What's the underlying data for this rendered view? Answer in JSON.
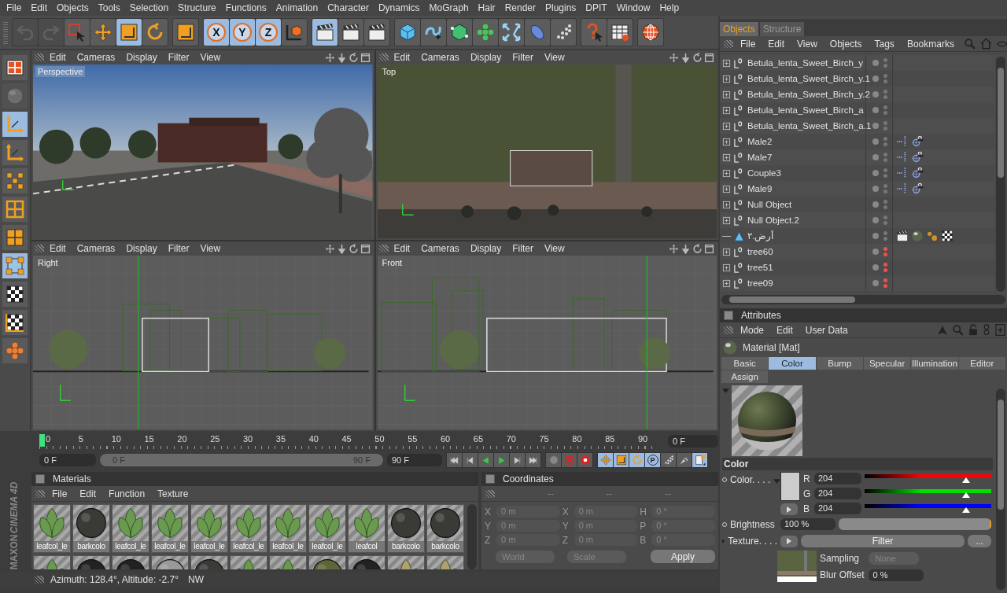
{
  "menu": [
    "File",
    "Edit",
    "Objects",
    "Tools",
    "Selection",
    "Structure",
    "Functions",
    "Animation",
    "Character",
    "Dynamics",
    "MoGraph",
    "Hair",
    "Render",
    "Plugins",
    "DPIT",
    "Window",
    "Help"
  ],
  "toolbar": [
    [
      {
        "kind": "undo",
        "selected": false,
        "disabled": true
      },
      {
        "kind": "redo",
        "selected": false,
        "disabled": true
      },
      {
        "kind": "select",
        "selected": false,
        "disabled": false
      },
      {
        "kind": "move",
        "selected": false,
        "disabled": false
      },
      {
        "kind": "scale",
        "selected": true,
        "disabled": false
      },
      {
        "kind": "rotate",
        "selected": false,
        "disabled": false
      }
    ],
    [
      {
        "kind": "square",
        "selected": false,
        "disabled": false
      }
    ],
    [
      {
        "kind": "axis_lock",
        "label": "X",
        "selected": true,
        "disabled": false
      },
      {
        "kind": "axis_lock",
        "label": "Y",
        "selected": true,
        "disabled": false
      },
      {
        "kind": "axis_lock",
        "label": "Z",
        "selected": true,
        "disabled": false
      },
      {
        "kind": "coord",
        "selected": false,
        "disabled": false
      }
    ],
    [
      {
        "kind": "clapper",
        "selected": true,
        "disabled": false
      },
      {
        "kind": "clapper",
        "selected": false,
        "disabled": false
      },
      {
        "kind": "clapper",
        "selected": false,
        "disabled": false
      }
    ],
    [
      {
        "kind": "cube",
        "selected": false,
        "disabled": false
      },
      {
        "kind": "spline",
        "selected": false,
        "disabled": false
      },
      {
        "kind": "nurbs",
        "selected": false,
        "disabled": false
      },
      {
        "kind": "array",
        "selected": false,
        "disabled": false
      },
      {
        "kind": "deformer",
        "selected": false,
        "disabled": false
      },
      {
        "kind": "env",
        "selected": false,
        "disabled": false
      },
      {
        "kind": "particles",
        "selected": false,
        "disabled": false
      }
    ],
    [
      {
        "kind": "help",
        "selected": false,
        "disabled": false
      },
      {
        "kind": "info",
        "selected": false,
        "disabled": false
      }
    ],
    [
      {
        "kind": "web",
        "selected": false,
        "disabled": false
      }
    ]
  ],
  "left_tools": [
    {
      "kind": "layout",
      "selected": false,
      "disabled": false
    },
    {
      "kind": "sphere",
      "selected": false,
      "disabled": true
    },
    {
      "kind": "axis",
      "selected": true,
      "disabled": false
    },
    {
      "kind": "axis",
      "selected": false,
      "disabled": false
    },
    {
      "kind": "points",
      "selected": false,
      "disabled": false
    },
    {
      "kind": "grid",
      "selected": false,
      "disabled": false
    },
    {
      "kind": "polygons",
      "selected": false,
      "disabled": false
    },
    {
      "kind": "nodes",
      "selected": true,
      "disabled": false
    },
    {
      "kind": "checker",
      "selected": false,
      "disabled": false
    },
    {
      "kind": "checkaxis",
      "selected": false,
      "disabled": false
    },
    {
      "kind": "sculpt",
      "selected": false,
      "disabled": false
    }
  ],
  "logo": [
    "MAXON",
    "CINEMA 4D"
  ],
  "viewports": [
    {
      "kind": "perspective",
      "label": "Perspective",
      "menu": [
        "Edit",
        "Cameras",
        "Display",
        "Filter",
        "View"
      ]
    },
    {
      "kind": "top",
      "label": "Top",
      "menu": [
        "Edit",
        "Cameras",
        "Display",
        "Filter",
        "View"
      ]
    },
    {
      "kind": "right",
      "label": "Right",
      "menu": [
        "Edit",
        "Cameras",
        "Display",
        "Filter",
        "View"
      ]
    },
    {
      "kind": "front",
      "label": "Front",
      "menu": [
        "Edit",
        "Cameras",
        "Display",
        "Filter",
        "View"
      ]
    }
  ],
  "timeline": {
    "ticks": [
      "0",
      "5",
      "10",
      "15",
      "20",
      "25",
      "30",
      "35",
      "40",
      "45",
      "50",
      "55",
      "60",
      "65",
      "70",
      "75",
      "80",
      "85",
      "90"
    ],
    "playhead": {
      "level": 0
    },
    "current": "0 F"
  },
  "range": {
    "start": "0 F",
    "slider_start": "0 F",
    "slider_end": "90 F",
    "end": "90 F",
    "level": 1
  },
  "playback": [
    {
      "kind": "first",
      "selected": false
    },
    {
      "kind": "prevkey",
      "selected": false
    },
    {
      "kind": "prev",
      "selected": false
    },
    {
      "kind": "play",
      "selected": false
    },
    {
      "kind": "nextkey",
      "selected": false
    },
    {
      "kind": "last",
      "selected": false
    }
  ],
  "record": [
    {
      "kind": "recgrey",
      "selected": false
    },
    {
      "kind": "rec",
      "selected": false
    },
    {
      "kind": "autokey",
      "selected": false
    }
  ],
  "modes": [
    {
      "kind": "move",
      "selected": true
    },
    {
      "kind": "scale",
      "selected": true
    },
    {
      "kind": "rotate",
      "selected": true
    },
    {
      "kind": "param",
      "label": "P",
      "selected": true
    },
    {
      "kind": "particles",
      "selected": false
    },
    {
      "kind": "light",
      "selected": false
    },
    {
      "kind": "doc",
      "selected": true
    }
  ],
  "materials": {
    "title": "Materials",
    "menu": [
      "File",
      "Edit",
      "Function",
      "Texture"
    ],
    "items": [
      {
        "kind": "leaf",
        "name": "leafcol_le"
      },
      {
        "kind": "bark",
        "name": "barkcolo"
      },
      {
        "kind": "leaf",
        "name": "leafcol_le"
      },
      {
        "kind": "leaf",
        "name": "leafcol_le"
      },
      {
        "kind": "leaf",
        "name": "leafcol_le"
      },
      {
        "kind": "leaf",
        "name": "leafcol_le"
      },
      {
        "kind": "leaf",
        "name": "leafcol_le"
      },
      {
        "kind": "leaf",
        "name": "leafcol_le"
      },
      {
        "kind": "leaf",
        "name": "leafcol"
      },
      {
        "kind": "bark",
        "name": "barkcolo"
      },
      {
        "kind": "bark",
        "name": "barkcolo"
      }
    ],
    "second_row": [
      {
        "kind": "leaf"
      },
      {
        "kind": "dark"
      },
      {
        "kind": "dark"
      },
      {
        "kind": "grey"
      },
      {
        "kind": "bark"
      },
      {
        "kind": "leaf"
      },
      {
        "kind": "leaf"
      },
      {
        "kind": "olive"
      },
      {
        "kind": "dark"
      },
      {
        "kind": "grass"
      },
      {
        "kind": "grass"
      }
    ]
  },
  "coordinates": {
    "title": "Coordinates",
    "columns": [
      "--",
      "--",
      "--"
    ],
    "disabled": true,
    "rows": [
      [
        {
          "axis": "X",
          "value": "0 m"
        },
        {
          "axis": "X",
          "value": "0 m"
        },
        {
          "axis": "H",
          "value": "0 °"
        }
      ],
      [
        {
          "axis": "Y",
          "value": "0 m"
        },
        {
          "axis": "Y",
          "value": "0 m"
        },
        {
          "axis": "P",
          "value": "0 °"
        }
      ],
      [
        {
          "axis": "Z",
          "value": "0 m"
        },
        {
          "axis": "Z",
          "value": "0 m"
        },
        {
          "axis": "B",
          "value": "0 °"
        }
      ]
    ],
    "space": "World",
    "mode": "Scale",
    "apply": "Apply"
  },
  "status": {
    "text": "Azimuth: 128.4°, Altitude: -2.7°",
    "direction": "NW"
  },
  "objects": {
    "tabs": [
      {
        "label": "Objects",
        "selected": true
      },
      {
        "label": "Structure",
        "selected": false
      }
    ],
    "menu": [
      "File",
      "Edit",
      "View",
      "Objects",
      "Tags",
      "Bookmarks"
    ],
    "rows": [
      {
        "name": "Betula_lenta_Sweet_Birch_y",
        "kind": "null",
        "expandable": true,
        "hidden": false,
        "tags": []
      },
      {
        "name": "Betula_lenta_Sweet_Birch_y.1",
        "kind": "null",
        "expandable": true,
        "hidden": false,
        "tags": []
      },
      {
        "name": "Betula_lenta_Sweet_Birch_y.2",
        "kind": "null",
        "expandable": true,
        "hidden": false,
        "tags": []
      },
      {
        "name": "Betula_lenta_Sweet_Birch_a",
        "kind": "null",
        "expandable": true,
        "hidden": false,
        "tags": []
      },
      {
        "name": "Betula_lenta_Sweet_Birch_a.1",
        "kind": "null",
        "expandable": true,
        "hidden": false,
        "tags": []
      },
      {
        "name": "Male2",
        "kind": "null",
        "expandable": true,
        "hidden": false,
        "tags": [
          {
            "kind": "ik"
          },
          {
            "kind": "motion"
          }
        ]
      },
      {
        "name": "Male7",
        "kind": "null",
        "expandable": true,
        "hidden": false,
        "tags": [
          {
            "kind": "ik"
          },
          {
            "kind": "motion"
          }
        ]
      },
      {
        "name": "Couple3",
        "kind": "null",
        "expandable": true,
        "hidden": false,
        "tags": [
          {
            "kind": "ik"
          },
          {
            "kind": "motion"
          }
        ]
      },
      {
        "name": "Male9",
        "kind": "null",
        "expandable": true,
        "hidden": false,
        "tags": [
          {
            "kind": "ik"
          },
          {
            "kind": "motion"
          }
        ]
      },
      {
        "name": "Null Object",
        "kind": "null",
        "expandable": true,
        "hidden": false,
        "tags": []
      },
      {
        "name": "Null Object.2",
        "kind": "null",
        "expandable": true,
        "hidden": false,
        "tags": []
      },
      {
        "name": "أرض.٢",
        "kind": "polygon",
        "expandable": false,
        "hidden": false,
        "tags": [
          {
            "kind": "clapper"
          },
          {
            "kind": "material"
          },
          {
            "kind": "balls"
          },
          {
            "kind": "checker"
          }
        ]
      },
      {
        "name": "tree60",
        "kind": "null",
        "expandable": true,
        "hidden": true,
        "tags": []
      },
      {
        "name": "tree51",
        "kind": "null",
        "expandable": true,
        "hidden": true,
        "tags": []
      },
      {
        "name": "tree09",
        "kind": "null",
        "expandable": true,
        "hidden": true,
        "tags": []
      }
    ]
  },
  "attributes": {
    "title": "Attributes",
    "menu": [
      "Mode",
      "Edit",
      "User Data"
    ],
    "material": "Material [Mat]",
    "tabs": [
      {
        "label": "Basic",
        "selected": false
      },
      {
        "label": "Color",
        "selected": true
      },
      {
        "label": "Bump",
        "selected": false
      },
      {
        "label": "Specular",
        "selected": false
      },
      {
        "label": "Illumination",
        "selected": false
      },
      {
        "label": "Editor",
        "selected": false
      },
      {
        "label": "Assign",
        "selected": false
      }
    ],
    "section": "Color",
    "color_label": "Color. . . .",
    "swatch": {
      "color": "#cccccc"
    },
    "channels": [
      {
        "name": "R",
        "value": "204",
        "level": 0.8,
        "color": "#ff0000"
      },
      {
        "name": "G",
        "value": "204",
        "level": 0.8,
        "color": "#00e000"
      },
      {
        "name": "B",
        "value": "204",
        "level": 0.8,
        "color": "#0000ff"
      }
    ],
    "brightness": {
      "label": "Brightness",
      "value": "100 %",
      "level": 1
    },
    "texture": {
      "label": "Texture. . . .",
      "button": "Filter",
      "more": "...",
      "sampling_label": "Sampling",
      "sampling": "None",
      "blur_label": "Blur Offset",
      "blur": "0 %"
    }
  }
}
